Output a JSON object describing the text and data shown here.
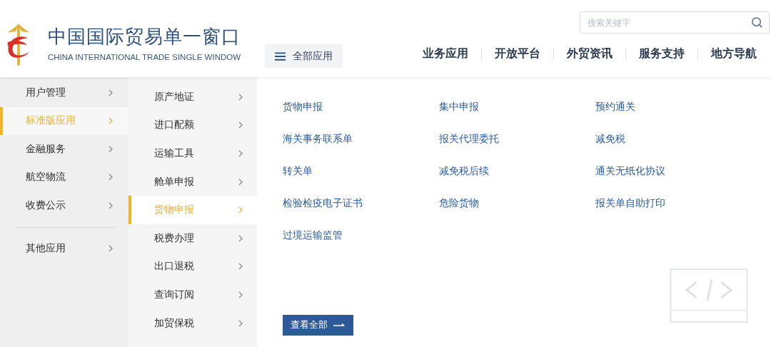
{
  "header": {
    "title": "中国国际贸易单一窗口",
    "subtitle": "CHINA INTERNATIONAL TRADE SINGLE WINDOW",
    "menu_button": "全部应用",
    "search": {
      "placeholder": "搜索关键字"
    },
    "nav": [
      "业务应用",
      "开放平台",
      "外贸资讯",
      "服务支持",
      "地方导航"
    ]
  },
  "sidebar": {
    "groups": [
      [
        {
          "label": "用户管理",
          "selected": false
        },
        {
          "label": "标准版应用",
          "selected": true
        },
        {
          "label": "金融服务",
          "selected": false
        },
        {
          "label": "航空物流",
          "selected": false
        },
        {
          "label": "收费公示",
          "selected": false
        }
      ],
      [
        {
          "label": "其他应用",
          "selected": false
        }
      ]
    ]
  },
  "submenu": [
    {
      "label": "原产地证",
      "selected": false
    },
    {
      "label": "进口配额",
      "selected": false
    },
    {
      "label": "运输工具",
      "selected": false
    },
    {
      "label": "舱单申报",
      "selected": false
    },
    {
      "label": "货物申报",
      "selected": true
    },
    {
      "label": "税费办理",
      "selected": false
    },
    {
      "label": "出口退税",
      "selected": false
    },
    {
      "label": "查询订阅",
      "selected": false
    },
    {
      "label": "加贸保税",
      "selected": false
    }
  ],
  "links": [
    "货物申报",
    "集中申报",
    "预约通关",
    "海关事务联系单",
    "报关代理委托",
    "减免税",
    "转关单",
    "减免税后续",
    "通关无纸化协议",
    "检验检疫电子证书",
    "危险货物",
    "报关单自助打印",
    "过境运输监管"
  ],
  "view_all_button": "查看全部"
}
